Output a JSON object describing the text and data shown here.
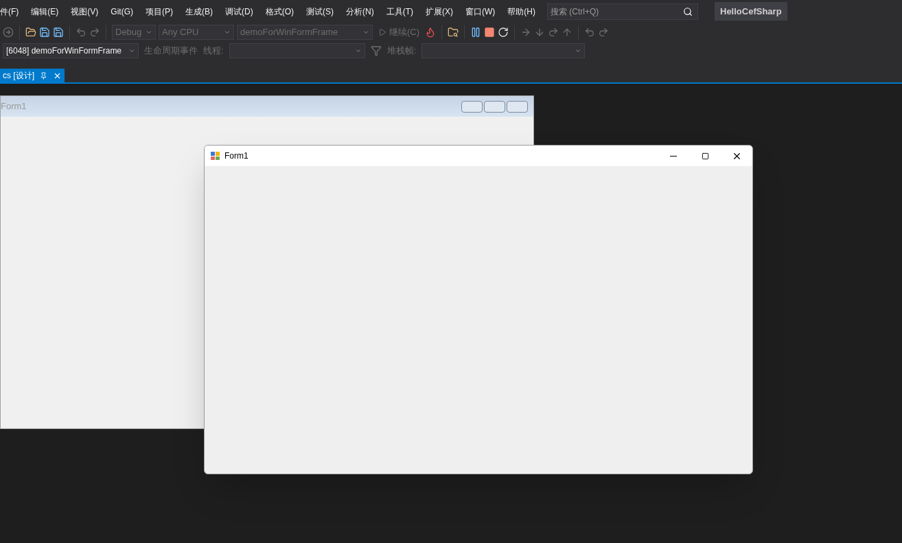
{
  "menu": [
    "件(F)",
    "编辑(E)",
    "视图(V)",
    "Git(G)",
    "项目(P)",
    "生成(B)",
    "调试(D)",
    "格式(O)",
    "测试(S)",
    "分析(N)",
    "工具(T)",
    "扩展(X)",
    "窗口(W)",
    "帮助(H)"
  ],
  "search": {
    "placeholder": "搜索 (Ctrl+Q)"
  },
  "solution_name": "HelloCefSharp",
  "toolbar": {
    "configuration": "Debug",
    "platform": "Any CPU",
    "startup_project": "demoForWinFormFrame",
    "continue": "继续(C)"
  },
  "debug_location": {
    "process": "[6048] demoForWinFormFrame",
    "lifecycle_events": "生命周期事件",
    "thread_label": "线程:",
    "stack_frame_label": "堆栈帧:"
  },
  "tabs": [
    {
      "label": "cs [设计]",
      "selected": true
    }
  ],
  "designer_form": {
    "title": "Form1"
  },
  "running_window": {
    "title": "Form1"
  }
}
